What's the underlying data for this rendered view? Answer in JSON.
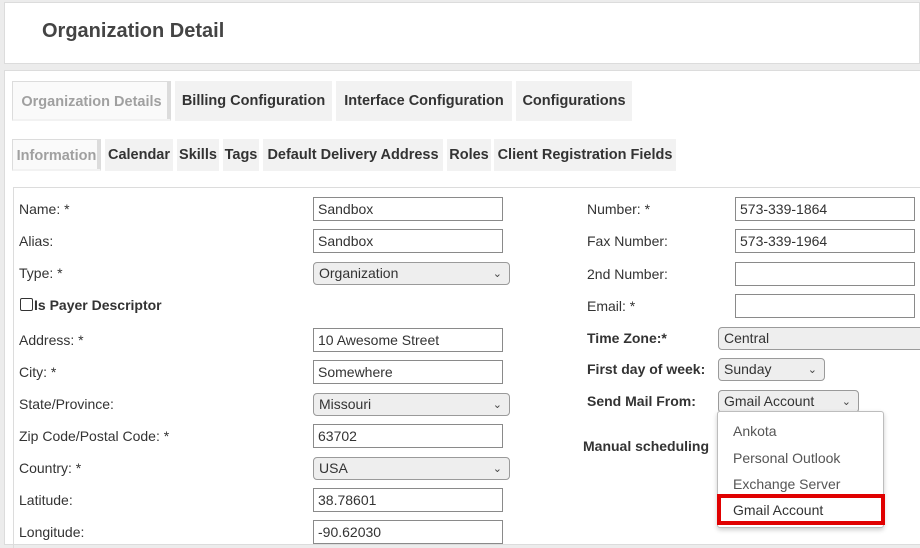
{
  "header": {
    "title": "Organization Detail"
  },
  "main_tabs": [
    {
      "label": "Organization Details",
      "active": true
    },
    {
      "label": "Billing Configuration",
      "active": false
    },
    {
      "label": "Interface Configuration",
      "active": false
    },
    {
      "label": "Configurations",
      "active": false
    }
  ],
  "sub_tabs": [
    {
      "label": "Information",
      "active": true
    },
    {
      "label": "Calendar",
      "active": false
    },
    {
      "label": "Skills",
      "active": false
    },
    {
      "label": "Tags",
      "active": false
    },
    {
      "label": "Default Delivery Address",
      "active": false
    },
    {
      "label": "Roles",
      "active": false
    },
    {
      "label": "Client Registration Fields",
      "active": false
    }
  ],
  "left_form": {
    "name": {
      "label": "Name: *",
      "value": "Sandbox"
    },
    "alias": {
      "label": "Alias:",
      "value": "Sandbox"
    },
    "type": {
      "label": "Type: *",
      "value": "Organization"
    },
    "payer": {
      "label": "Is Payer Descriptor",
      "checked": false
    },
    "address": {
      "label": "Address: *",
      "value": "10 Awesome Street"
    },
    "city": {
      "label": "City: *",
      "value": "Somewhere"
    },
    "state": {
      "label": "State/Province:",
      "value": "Missouri"
    },
    "zip": {
      "label": "Zip Code/Postal Code: *",
      "value": "63702"
    },
    "country": {
      "label": "Country: *",
      "value": "USA"
    },
    "latitude": {
      "label": "Latitude:",
      "value": "38.78601"
    },
    "longitude": {
      "label": "Longitude:",
      "value": "-90.62030"
    }
  },
  "right_form": {
    "number": {
      "label": "Number: *",
      "value": "573-339-1864"
    },
    "fax": {
      "label": "Fax Number:",
      "value": "573-339-1964"
    },
    "second_number": {
      "label": "2nd Number:",
      "value": ""
    },
    "email": {
      "label": "Email: *",
      "value": ""
    },
    "timezone": {
      "label": "Time Zone:*",
      "value": "Central"
    },
    "first_day": {
      "label": "First day of week:",
      "value": "Sunday"
    },
    "send_mail": {
      "label": "Send Mail From:",
      "value": "Gmail Account"
    },
    "manual_scheduling": {
      "label": "Manual scheduling"
    }
  },
  "mail_dropdown": {
    "options": [
      "Ankota",
      "Personal Outlook",
      "Exchange Server",
      "Gmail Account"
    ],
    "highlighted": "Gmail Account",
    "highlight_color": "#e00000"
  }
}
